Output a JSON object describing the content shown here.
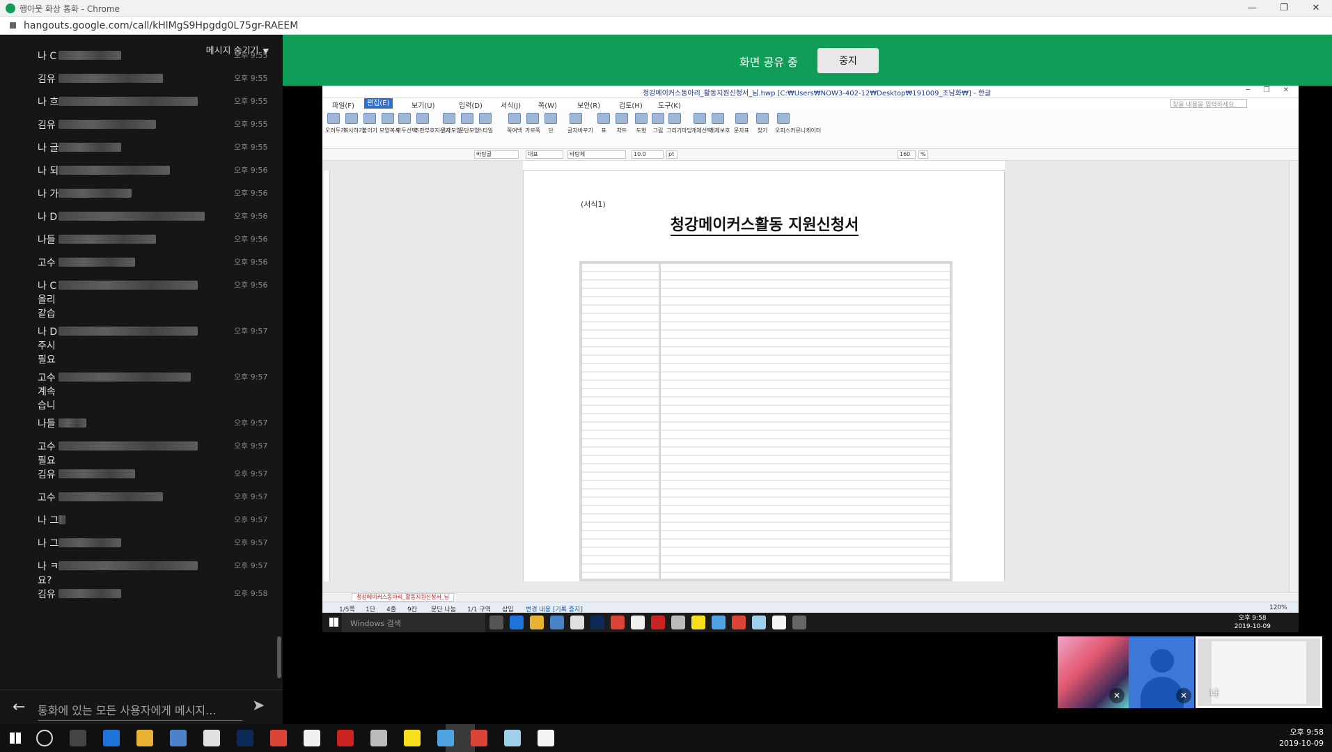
{
  "window": {
    "title": "행아웃 화상 통화 - Chrome",
    "url": "hangouts.google.com/call/kHlMgS9Hpgdg0L75gr-RAEEM",
    "buttons": [
      "—",
      "❐",
      "✕"
    ]
  },
  "chat": {
    "hide_label": "메시지 숨기기",
    "messages": [
      {
        "sender": "나",
        "time": "오후 9:55",
        "lines": [
          "나 C"
        ]
      },
      {
        "sender": "김유",
        "time": "오후 9:55",
        "lines": [
          "김유"
        ]
      },
      {
        "sender": "나",
        "time": "오후 9:55",
        "lines": [
          "나 흐"
        ]
      },
      {
        "sender": "김유",
        "time": "오후 9:55",
        "lines": [
          "김유"
        ]
      },
      {
        "sender": "나",
        "time": "오후 9:55",
        "lines": [
          "나 글"
        ]
      },
      {
        "sender": "나",
        "time": "오후 9:56",
        "lines": [
          "나 되"
        ]
      },
      {
        "sender": "나",
        "time": "오후 9:56",
        "lines": [
          "나 가"
        ]
      },
      {
        "sender": "나",
        "time": "오후 9:56",
        "lines": [
          "나 D"
        ]
      },
      {
        "sender": "나들",
        "time": "오후 9:56",
        "lines": [
          "나들"
        ]
      },
      {
        "sender": "고수",
        "time": "오후 9:56",
        "lines": [
          "고수"
        ]
      },
      {
        "sender": "나",
        "time": "오후 9:56",
        "lines": [
          "나 C",
          "올리",
          "같습"
        ]
      },
      {
        "sender": "나",
        "time": "오후 9:57",
        "lines": [
          "나 D",
          "주시",
          "필요"
        ]
      },
      {
        "sender": "고수",
        "time": "오후 9:57",
        "lines": [
          "고수",
          "계속",
          "습니"
        ]
      },
      {
        "sender": "나들",
        "time": "오후 9:57",
        "lines": [
          "나들"
        ]
      },
      {
        "sender": "고수",
        "time": "오후 9:57",
        "lines": [
          "고수",
          "필요"
        ]
      },
      {
        "sender": "김유",
        "time": "오후 9:57",
        "lines": [
          "김유"
        ]
      },
      {
        "sender": "고수",
        "time": "오후 9:57",
        "lines": [
          "고수"
        ]
      },
      {
        "sender": "나",
        "time": "오후 9:57",
        "lines": [
          "나 그"
        ]
      },
      {
        "sender": "나",
        "time": "오후 9:57",
        "lines": [
          "나 그"
        ]
      },
      {
        "sender": "나",
        "time": "오후 9:57",
        "lines": [
          "나 ㅋ",
          "요?"
        ]
      },
      {
        "sender": "김유",
        "time": "오후 9:58",
        "lines": [
          "김유"
        ]
      }
    ],
    "input_placeholder": "통화에 있는 모든 사용자에게 메시지..."
  },
  "share": {
    "status_label": "화면 공유 중",
    "stop_label": "중지"
  },
  "hwp": {
    "title": "청강메이커스동아리_활동지원신청서_님.hwp [C:₩Users₩NOW3-402-12₩Desktop₩191009_조남화₩] - 한글",
    "menu": [
      "파일(F)",
      "편집(E)",
      "보기(U)",
      "입력(D)",
      "서식(J)",
      "쪽(W)",
      "보안(R)",
      "검토(H)",
      "도구(K)"
    ],
    "active_menu": "편집(E)",
    "search_placeholder": "찾을 내용을 입력하세요.",
    "ribbon": [
      "오려두기",
      "복사하기",
      "붙이기",
      "모양복사",
      "모두선택",
      "조판부호지우기",
      "글자모양",
      "문단모양",
      "스타일",
      "쪽여백",
      "가로쪽",
      "단",
      "글자바꾸기",
      "표",
      "차트",
      "도형",
      "그림",
      "그리기마당",
      "개체선택",
      "개체보호",
      "문자표",
      "찾기",
      "오피스커뮤니케이터"
    ],
    "format_boxes": [
      "바탕글",
      "대표",
      "바탕체",
      "10.0",
      "pt",
      "160",
      "%"
    ],
    "form_label": "(서식1)",
    "doc_title": "청강메이커스활동 지원신청서",
    "tab_label": "청강메이커스동아리_활동지원신청서_님",
    "status": [
      "1/5쪽",
      "1단",
      "4줄",
      "9칸",
      "문단 나눔",
      "1/1 구역",
      "삽입",
      "변경 내용 [기록 중지]",
      "120%"
    ]
  },
  "inner_taskbar": {
    "search_placeholder": "Windows 검색",
    "time": "오후 9:58",
    "date": "2019-10-09"
  },
  "thumbs": {
    "me_label": "나"
  },
  "taskbar": {
    "time": "오후 9:58",
    "date": "2019-10-09"
  },
  "colors": {
    "hangouts_green": "#0f9d58",
    "chat_bg": "#161616",
    "hwp_accent": "#2f6fc7"
  }
}
